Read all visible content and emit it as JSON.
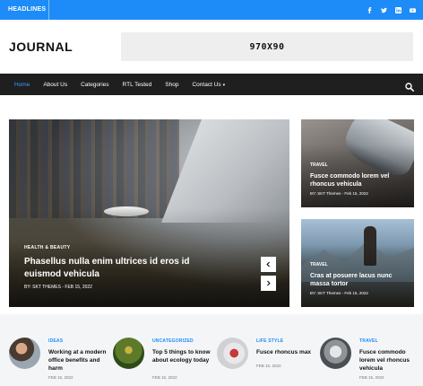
{
  "topbar": {
    "headlines_label": "HEADLINES",
    "socials": [
      "facebook-icon",
      "twitter-icon",
      "linkedin-icon",
      "youtube-icon"
    ],
    "bg_color": "#1d8cf8"
  },
  "header": {
    "logo": "JOURNAL",
    "ad_label": "970X90"
  },
  "nav": {
    "items": [
      {
        "label": "Home",
        "active": true
      },
      {
        "label": "About Us"
      },
      {
        "label": "Categories"
      },
      {
        "label": "RTL Tested"
      },
      {
        "label": "Shop"
      },
      {
        "label": "Contact Us",
        "dropdown": true
      }
    ],
    "active_color": "#3a9bff"
  },
  "hero": {
    "category": "HEALTH & BEAUTY",
    "title": "Phasellus nulla enim ultrices id eros id euismod vehicula",
    "meta": "BY: SKT THEMES - FEB 15, 2022"
  },
  "side_posts": [
    {
      "category": "TRAVEL",
      "title": "Fusce commodo lorem vel rhoncus vehicula",
      "meta": "BY: SKT Themes - Feb 15, 2022"
    },
    {
      "category": "TRAVEL",
      "title": "Cras at posuere lacus nunc massa tortor",
      "meta": "BY: SKT Themes - Feb 15, 2022"
    }
  ],
  "mini_posts": [
    {
      "category": "IDEAS",
      "title": "Working at a modern office benefits and harm",
      "date": "FEB 15, 2022"
    },
    {
      "category": "UNCATEGORIZED",
      "title": "Top 5 things to know about ecology today",
      "date": "FEB 15, 2022"
    },
    {
      "category": "LIFE STYLE",
      "title": "Fusce rhoncus max",
      "date": "FEB 15, 2022"
    },
    {
      "category": "TRAVEL",
      "title": "Fusce commodo lorem vel rhoncus vehicula",
      "date": "FEB 15, 2022"
    }
  ]
}
